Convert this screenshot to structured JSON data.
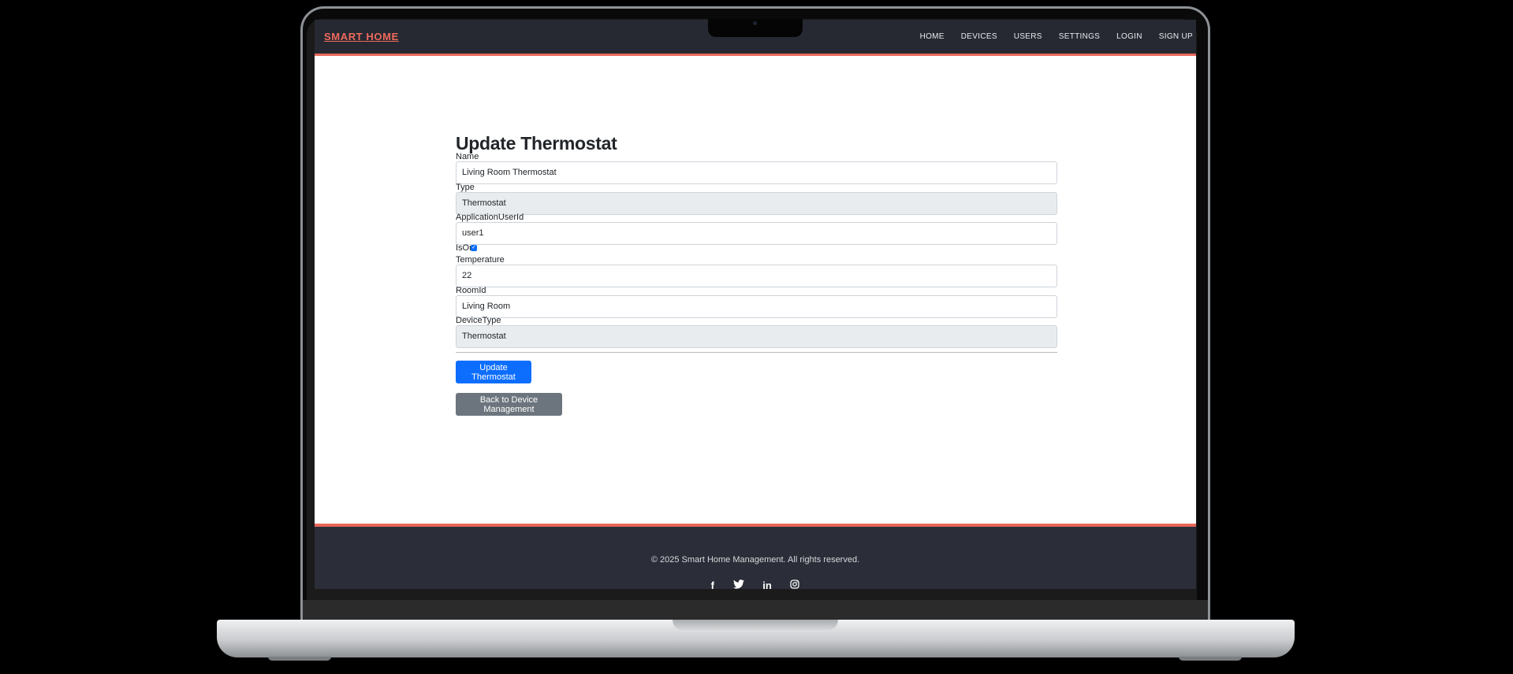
{
  "brand": "SMART HOME",
  "nav": [
    "HOME",
    "DEVICES",
    "USERS",
    "SETTINGS",
    "LOGIN",
    "SIGN UP"
  ],
  "page_title": "Update Thermostat",
  "fields": {
    "name": {
      "label": "Name",
      "value": "Living Room Thermostat"
    },
    "type": {
      "label": "Type",
      "value": "Thermostat"
    },
    "app_user": {
      "label": "ApplicationUserId",
      "value": "user1"
    },
    "is_on": {
      "label": "IsOn",
      "checked": true
    },
    "temperature": {
      "label": "Temperature",
      "value": "22"
    },
    "room": {
      "label": "RoomId",
      "value": "Living Room"
    },
    "device_type": {
      "label": "DeviceType",
      "value": "Thermostat"
    }
  },
  "buttons": {
    "update": "Update Thermostat",
    "back": "Back to Device Management"
  },
  "footer": {
    "copyright": "© 2025 Smart Home Management. All rights reserved.",
    "social": [
      "facebook-icon",
      "twitter-icon",
      "linkedin-icon",
      "instagram-icon"
    ]
  },
  "colors": {
    "accent": "#e8675a",
    "primary": "#0d6efd",
    "secondary": "#6c757d",
    "navbar": "#262932"
  }
}
